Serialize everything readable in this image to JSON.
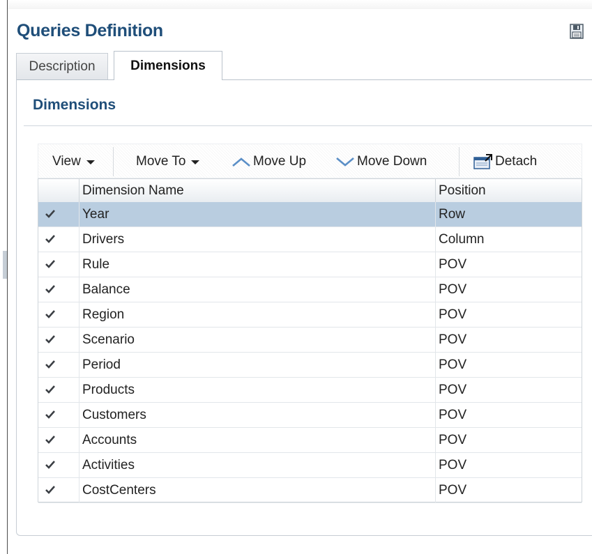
{
  "window": {
    "title": "Queries Definition",
    "save_icon": "save-icon"
  },
  "tabs": [
    {
      "label": "Description",
      "active": false
    },
    {
      "label": "Dimensions",
      "active": true
    }
  ],
  "section": {
    "title": "Dimensions"
  },
  "toolbar": {
    "view_label": "View",
    "move_to_label": "Move To",
    "move_up_label": "Move Up",
    "move_down_label": "Move Down",
    "detach_label": "Detach",
    "icons": [
      "chevron-up-icon",
      "chevron-down-icon",
      "detach-icon"
    ]
  },
  "table": {
    "columns": [
      "Dimension Name",
      "Position"
    ],
    "rows": [
      {
        "name": "Year",
        "position": "Row",
        "checked": true,
        "selected": true
      },
      {
        "name": "Drivers",
        "position": "Column",
        "checked": true,
        "selected": false
      },
      {
        "name": "Rule",
        "position": "POV",
        "checked": true,
        "selected": false
      },
      {
        "name": "Balance",
        "position": "POV",
        "checked": true,
        "selected": false
      },
      {
        "name": "Region",
        "position": "POV",
        "checked": true,
        "selected": false
      },
      {
        "name": "Scenario",
        "position": "POV",
        "checked": true,
        "selected": false
      },
      {
        "name": "Period",
        "position": "POV",
        "checked": true,
        "selected": false
      },
      {
        "name": "Products",
        "position": "POV",
        "checked": true,
        "selected": false
      },
      {
        "name": "Customers",
        "position": "POV",
        "checked": true,
        "selected": false
      },
      {
        "name": "Accounts",
        "position": "POV",
        "checked": true,
        "selected": false
      },
      {
        "name": "Activities",
        "position": "POV",
        "checked": true,
        "selected": false
      },
      {
        "name": "CostCenters",
        "position": "POV",
        "checked": true,
        "selected": false
      }
    ]
  },
  "colors": {
    "title": "#1f4e79",
    "selected_row": "#b9cde0",
    "check": "#3b3f44",
    "chevron": "#5b8fc7"
  }
}
